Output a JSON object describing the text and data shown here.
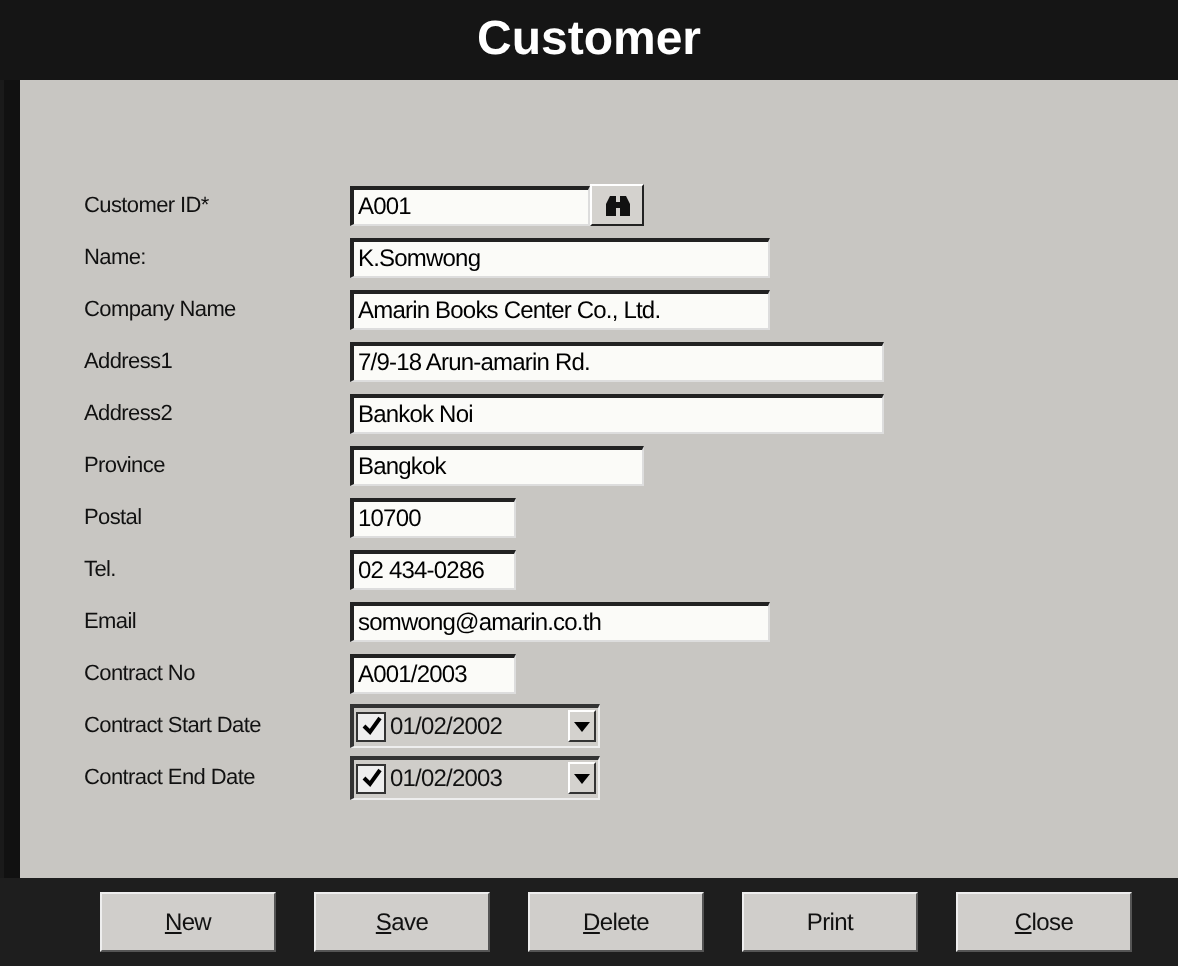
{
  "window": {
    "title": "Customer"
  },
  "fields": [
    {
      "label": "Customer ID*",
      "value": "A001",
      "kind": "lookup"
    },
    {
      "label": "Name:",
      "value": "K.Somwong",
      "kind": "text"
    },
    {
      "label": "Company Name",
      "value": "Amarin Books Center Co., Ltd.",
      "kind": "text"
    },
    {
      "label": "Address1",
      "value": "7/9-18 Arun-amarin Rd.",
      "kind": "text"
    },
    {
      "label": "Address2",
      "value": "Bankok Noi",
      "kind": "text"
    },
    {
      "label": "Province",
      "value": "Bangkok",
      "kind": "text"
    },
    {
      "label": "Postal",
      "value": "10700",
      "kind": "text"
    },
    {
      "label": "Tel.",
      "value": "02 434-0286",
      "kind": "text"
    },
    {
      "label": "Email",
      "value": "somwong@amarin.co.th",
      "kind": "text"
    },
    {
      "label": "Contract No",
      "value": "A001/2003",
      "kind": "text"
    },
    {
      "label": "Contract Start Date",
      "value": "01/02/2002",
      "kind": "date",
      "checked": true
    },
    {
      "label": "Contract End Date",
      "value": "01/02/2003",
      "kind": "date",
      "checked": true
    }
  ],
  "buttons": [
    {
      "label": "New",
      "mnemonic": true
    },
    {
      "label": "Save",
      "mnemonic": true
    },
    {
      "label": "Delete",
      "mnemonic": true
    },
    {
      "label": "Print",
      "mnemonic": false
    },
    {
      "label": "Close",
      "mnemonic": true
    }
  ]
}
